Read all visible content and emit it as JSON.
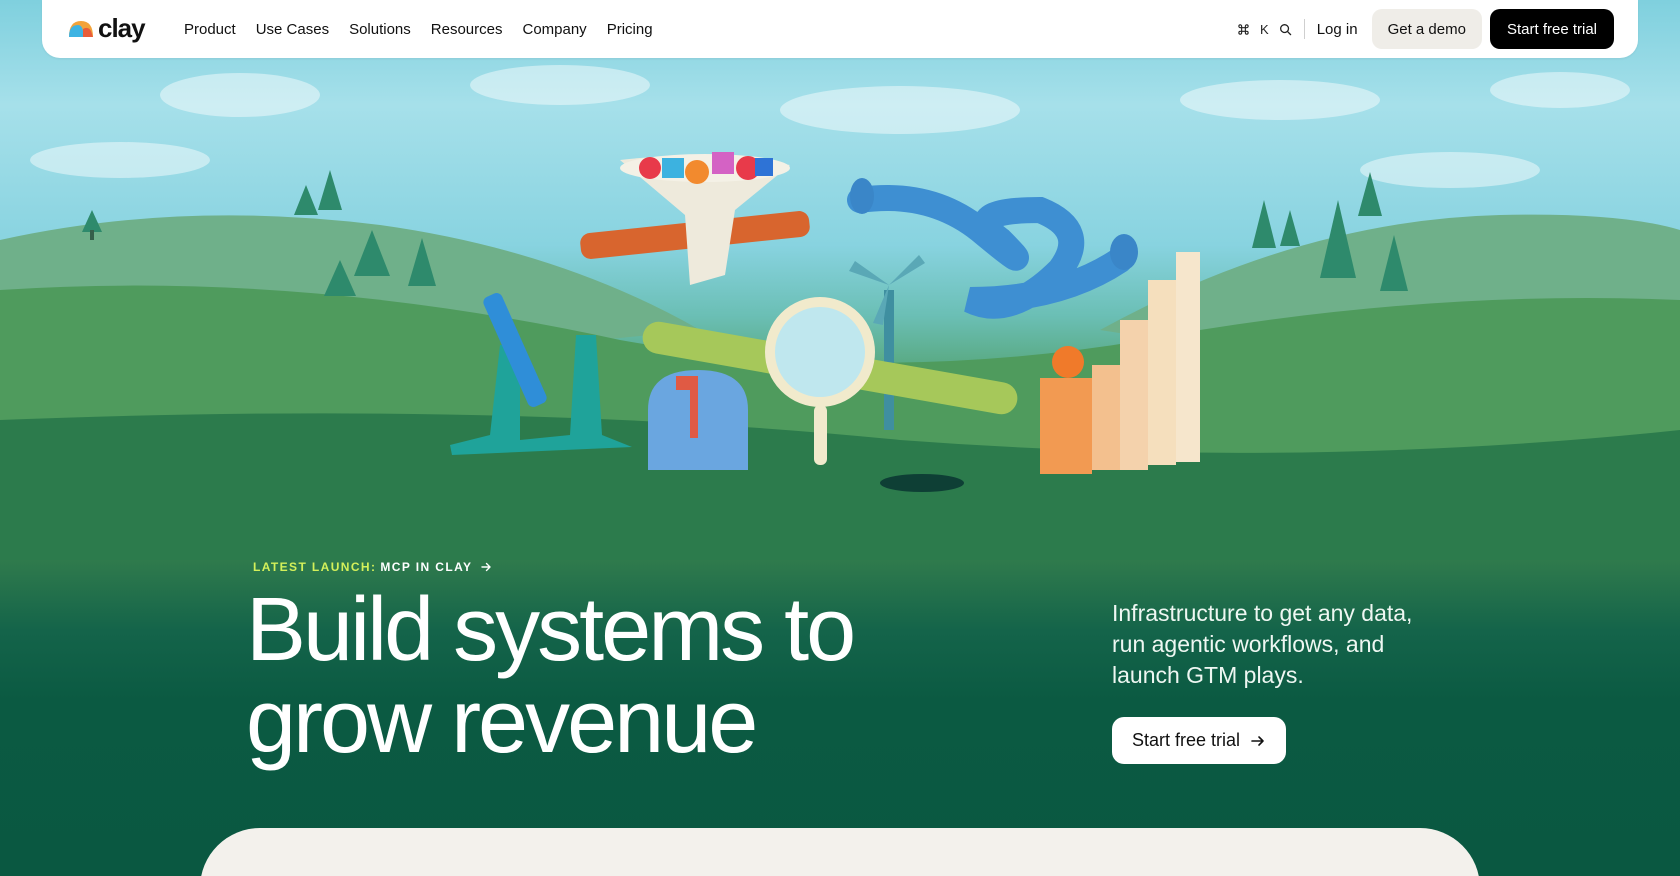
{
  "brand": {
    "name": "clay"
  },
  "nav": {
    "links": [
      "Product",
      "Use Cases",
      "Solutions",
      "Resources",
      "Company",
      "Pricing"
    ],
    "shortcut_key": "K",
    "login": "Log in",
    "demo_button": "Get a demo",
    "trial_button": "Start free trial"
  },
  "hero": {
    "launch_label": "LATEST LAUNCH:",
    "launch_value": "MCP IN CLAY",
    "headline_line1": "Build systems to",
    "headline_line2": "grow revenue",
    "subcopy": "Infrastructure to get any data, run agentic workflows, and launch GTM plays.",
    "cta": "Start free trial"
  },
  "icons": [
    "command-icon",
    "search-icon",
    "arrow-right-icon"
  ],
  "colors": {
    "brand_green": "#0b5a41",
    "accent_lime": "#d4f05a",
    "button_dark": "#000000",
    "button_light": "#efede8",
    "panel": "#f3f1ec"
  }
}
